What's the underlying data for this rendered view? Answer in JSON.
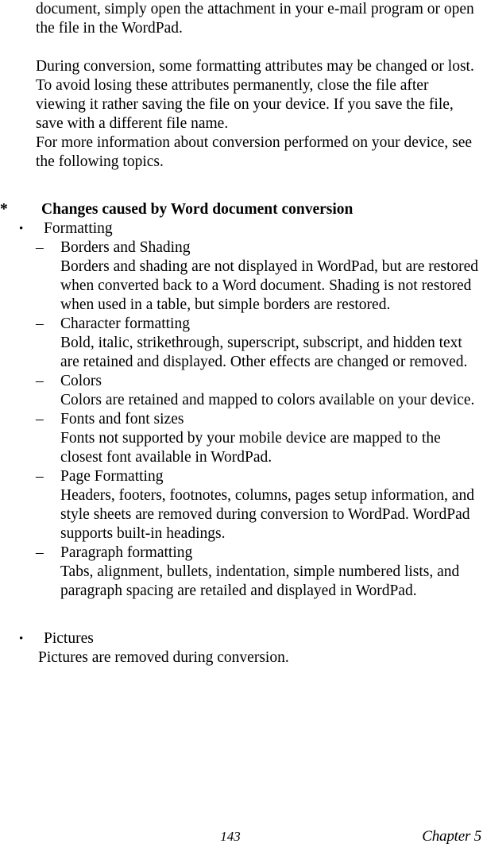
{
  "page": {
    "intro_paragraph_1": "document, simply open the attachment in your e-mail program or open the file in the WordPad.",
    "intro_paragraph_2": "During conversion, some formatting attributes may be changed or lost. To avoid losing these attributes permanently, close the file after viewing it rather saving the file on your device. If you save the file, save with a different file name.",
    "intro_paragraph_3": "For more information about conversion performed on your device, see the following topics."
  },
  "markers": {
    "star": "*",
    "bullet": "•",
    "dash": "–"
  },
  "section": {
    "heading": "Changes caused by Word document conversion",
    "bullets": [
      {
        "title": "Formatting",
        "items": [
          {
            "title": "Borders and Shading",
            "text": "Borders and shading are not displayed in WordPad, but are restored when converted back to a Word document. Shading is not restored when used in a table, but simple borders are restored."
          },
          {
            "title": "Character formatting",
            "text": "Bold, italic, strikethrough, superscript, subscript, and hidden text are retained and displayed. Other effects are changed or removed."
          },
          {
            "title": "Colors",
            "text": "Colors are retained and mapped to colors available on your device."
          },
          {
            "title": "Fonts and font sizes",
            "text": "Fonts not supported by your mobile device are mapped to the closest font available in WordPad."
          },
          {
            "title": "Page Formatting",
            "text": "Headers, footers, footnotes, columns, pages setup information, and style sheets are removed during conversion to WordPad. WordPad supports built-in headings."
          },
          {
            "title": "Paragraph formatting",
            "text": "Tabs, alignment, bullets, indentation, simple numbered lists, and paragraph spacing are retailed and displayed in WordPad."
          }
        ]
      },
      {
        "title": "Pictures",
        "description": "Pictures are removed during conversion.",
        "items": []
      }
    ]
  },
  "footer": {
    "page_number": "143",
    "chapter": "Chapter 5"
  }
}
